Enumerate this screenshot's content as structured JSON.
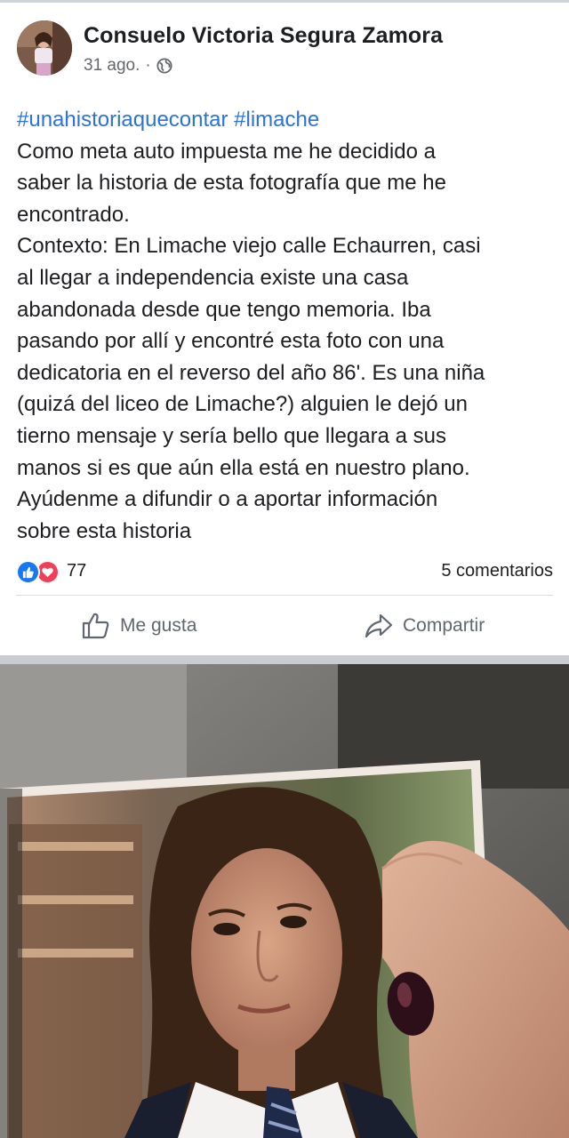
{
  "post": {
    "author": "Consuelo Victoria Segura Zamora",
    "date": "31 ago.",
    "separator": "·",
    "privacy_icon": "globe-icon",
    "hashtags": "#unahistoriaquecontar #limache",
    "body_lines": [
      "Como meta auto impuesta me he decidido a",
      "saber la historia de esta fotografía que me he",
      "encontrado.",
      "Contexto: En Limache viejo calle Echaurren, casi",
      "al llegar a independencia existe una casa",
      "abandonada desde que tengo memoria. Iba",
      "pasando por allí y encontré esta foto con una",
      "dedicatoria en el reverso del año 86'. Es una niña",
      "(quizá del liceo de Limache?) alguien le dejó un",
      "tierno mensaje y sería bello que llegara a sus",
      "manos si es que aún ella está en nuestro plano.",
      "Ayúdenme a difundir o a aportar información",
      "sobre esta historia"
    ]
  },
  "reactions": {
    "types": [
      "like",
      "love"
    ],
    "count": "77",
    "comments": "5 comentarios"
  },
  "actions": {
    "like_label": "Me gusta",
    "share_label": "Compartir"
  },
  "colors": {
    "hashtag": "#2d72d8",
    "like": "#1877f2",
    "love": "#f33e58",
    "secondary_text": "#65676b"
  }
}
